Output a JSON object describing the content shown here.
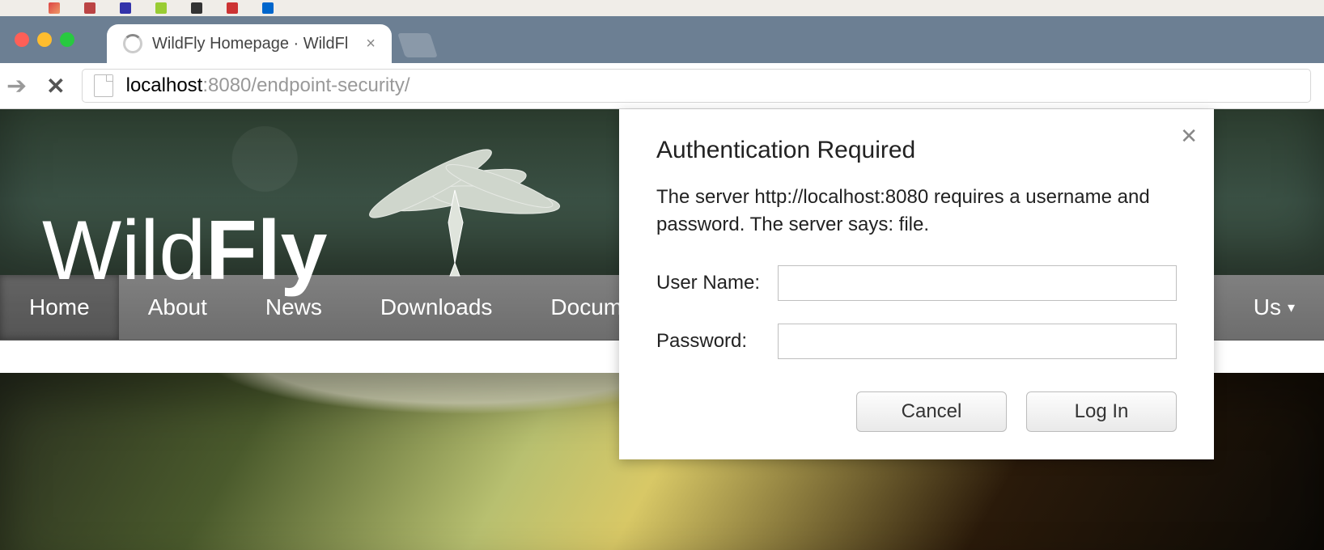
{
  "browser": {
    "tab_title": "WildFly Homepage · WildFl",
    "url_host": "localhost",
    "url_port": ":8080",
    "url_path": "/endpoint-security/"
  },
  "site": {
    "logo_text_light": "Wild",
    "logo_text_bold": "Fly"
  },
  "nav": {
    "items": [
      {
        "label": "Home",
        "active": true
      },
      {
        "label": "About"
      },
      {
        "label": "News"
      },
      {
        "label": "Downloads"
      },
      {
        "label": "Document"
      }
    ],
    "right_item_label": "Us",
    "right_item_caret": "▾"
  },
  "auth": {
    "title": "Authentication Required",
    "message": "The server http://localhost:8080 requires a username and password. The server says: file.",
    "labels": {
      "user": "User Name:",
      "pass": "Password:"
    },
    "values": {
      "user": "",
      "pass": ""
    },
    "buttons": {
      "cancel": "Cancel",
      "login": "Log In"
    },
    "close_icon": "✕"
  }
}
